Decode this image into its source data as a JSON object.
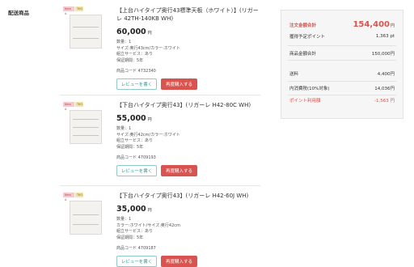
{
  "section_label": "配送商品",
  "items": [
    {
      "tag_a": "Item A",
      "tag_b": "TKG",
      "name": "【上台ハイタイプ奥行43標準天板（ホワイト）】(リガーレ 42TH-140KB WH)",
      "price": "60,000",
      "yen": "円",
      "qty": "数量：1",
      "spec": "サイズ:奥行43cm/カラー:ホワイト",
      "assembly": "組立サービス：あり",
      "warranty": "保証期間：5年",
      "code": "商品コード 4732340",
      "review_label": "レビューを書く",
      "reorder_label": "再度購入する"
    },
    {
      "tag_a": "Item A",
      "tag_b": "TKG",
      "name": "【下台ハイタイプ奥行43】(リガーレ H42-80C WH)",
      "price": "55,000",
      "yen": "円",
      "qty": "数量：1",
      "spec": "サイズ:奥行42cm/カラー:ホワイト",
      "assembly": "組立サービス：あり",
      "warranty": "保証期間：5年",
      "code": "商品コード 4709193",
      "review_label": "レビューを書く",
      "reorder_label": "再度購入する"
    },
    {
      "tag_a": "Item A",
      "tag_b": "TKG",
      "name": "【下台ハイタイプ奥行43】(リガーレ H42-60J WH)",
      "price": "35,000",
      "yen": "円",
      "qty": "数量：1",
      "spec": "カラー:ホワイト/サイズ:奥行42cm",
      "assembly": "組立サービス：あり",
      "warranty": "保証期間：5年",
      "code": "商品コード 4709187",
      "review_label": "レビューを書く",
      "reorder_label": "再度購入する"
    }
  ],
  "summary": {
    "total_label": "注文金額合計",
    "total_value": "154,400",
    "total_unit": "円",
    "points_label": "獲得予定ポイント",
    "points_value": "1,363 pt",
    "subtotal_label": "商品金額合計",
    "subtotal_value": "150,000円",
    "shipping_label": "送料",
    "shipping_value": "4,400円",
    "tax_label": "内消費税(10%対象)",
    "tax_value": "14,036円",
    "point_use_label": "ポイント利用額",
    "point_use_value": "-1,563 円"
  },
  "colors": {
    "accent_red": "#d9534f",
    "review_teal": "#3a9a9a"
  }
}
